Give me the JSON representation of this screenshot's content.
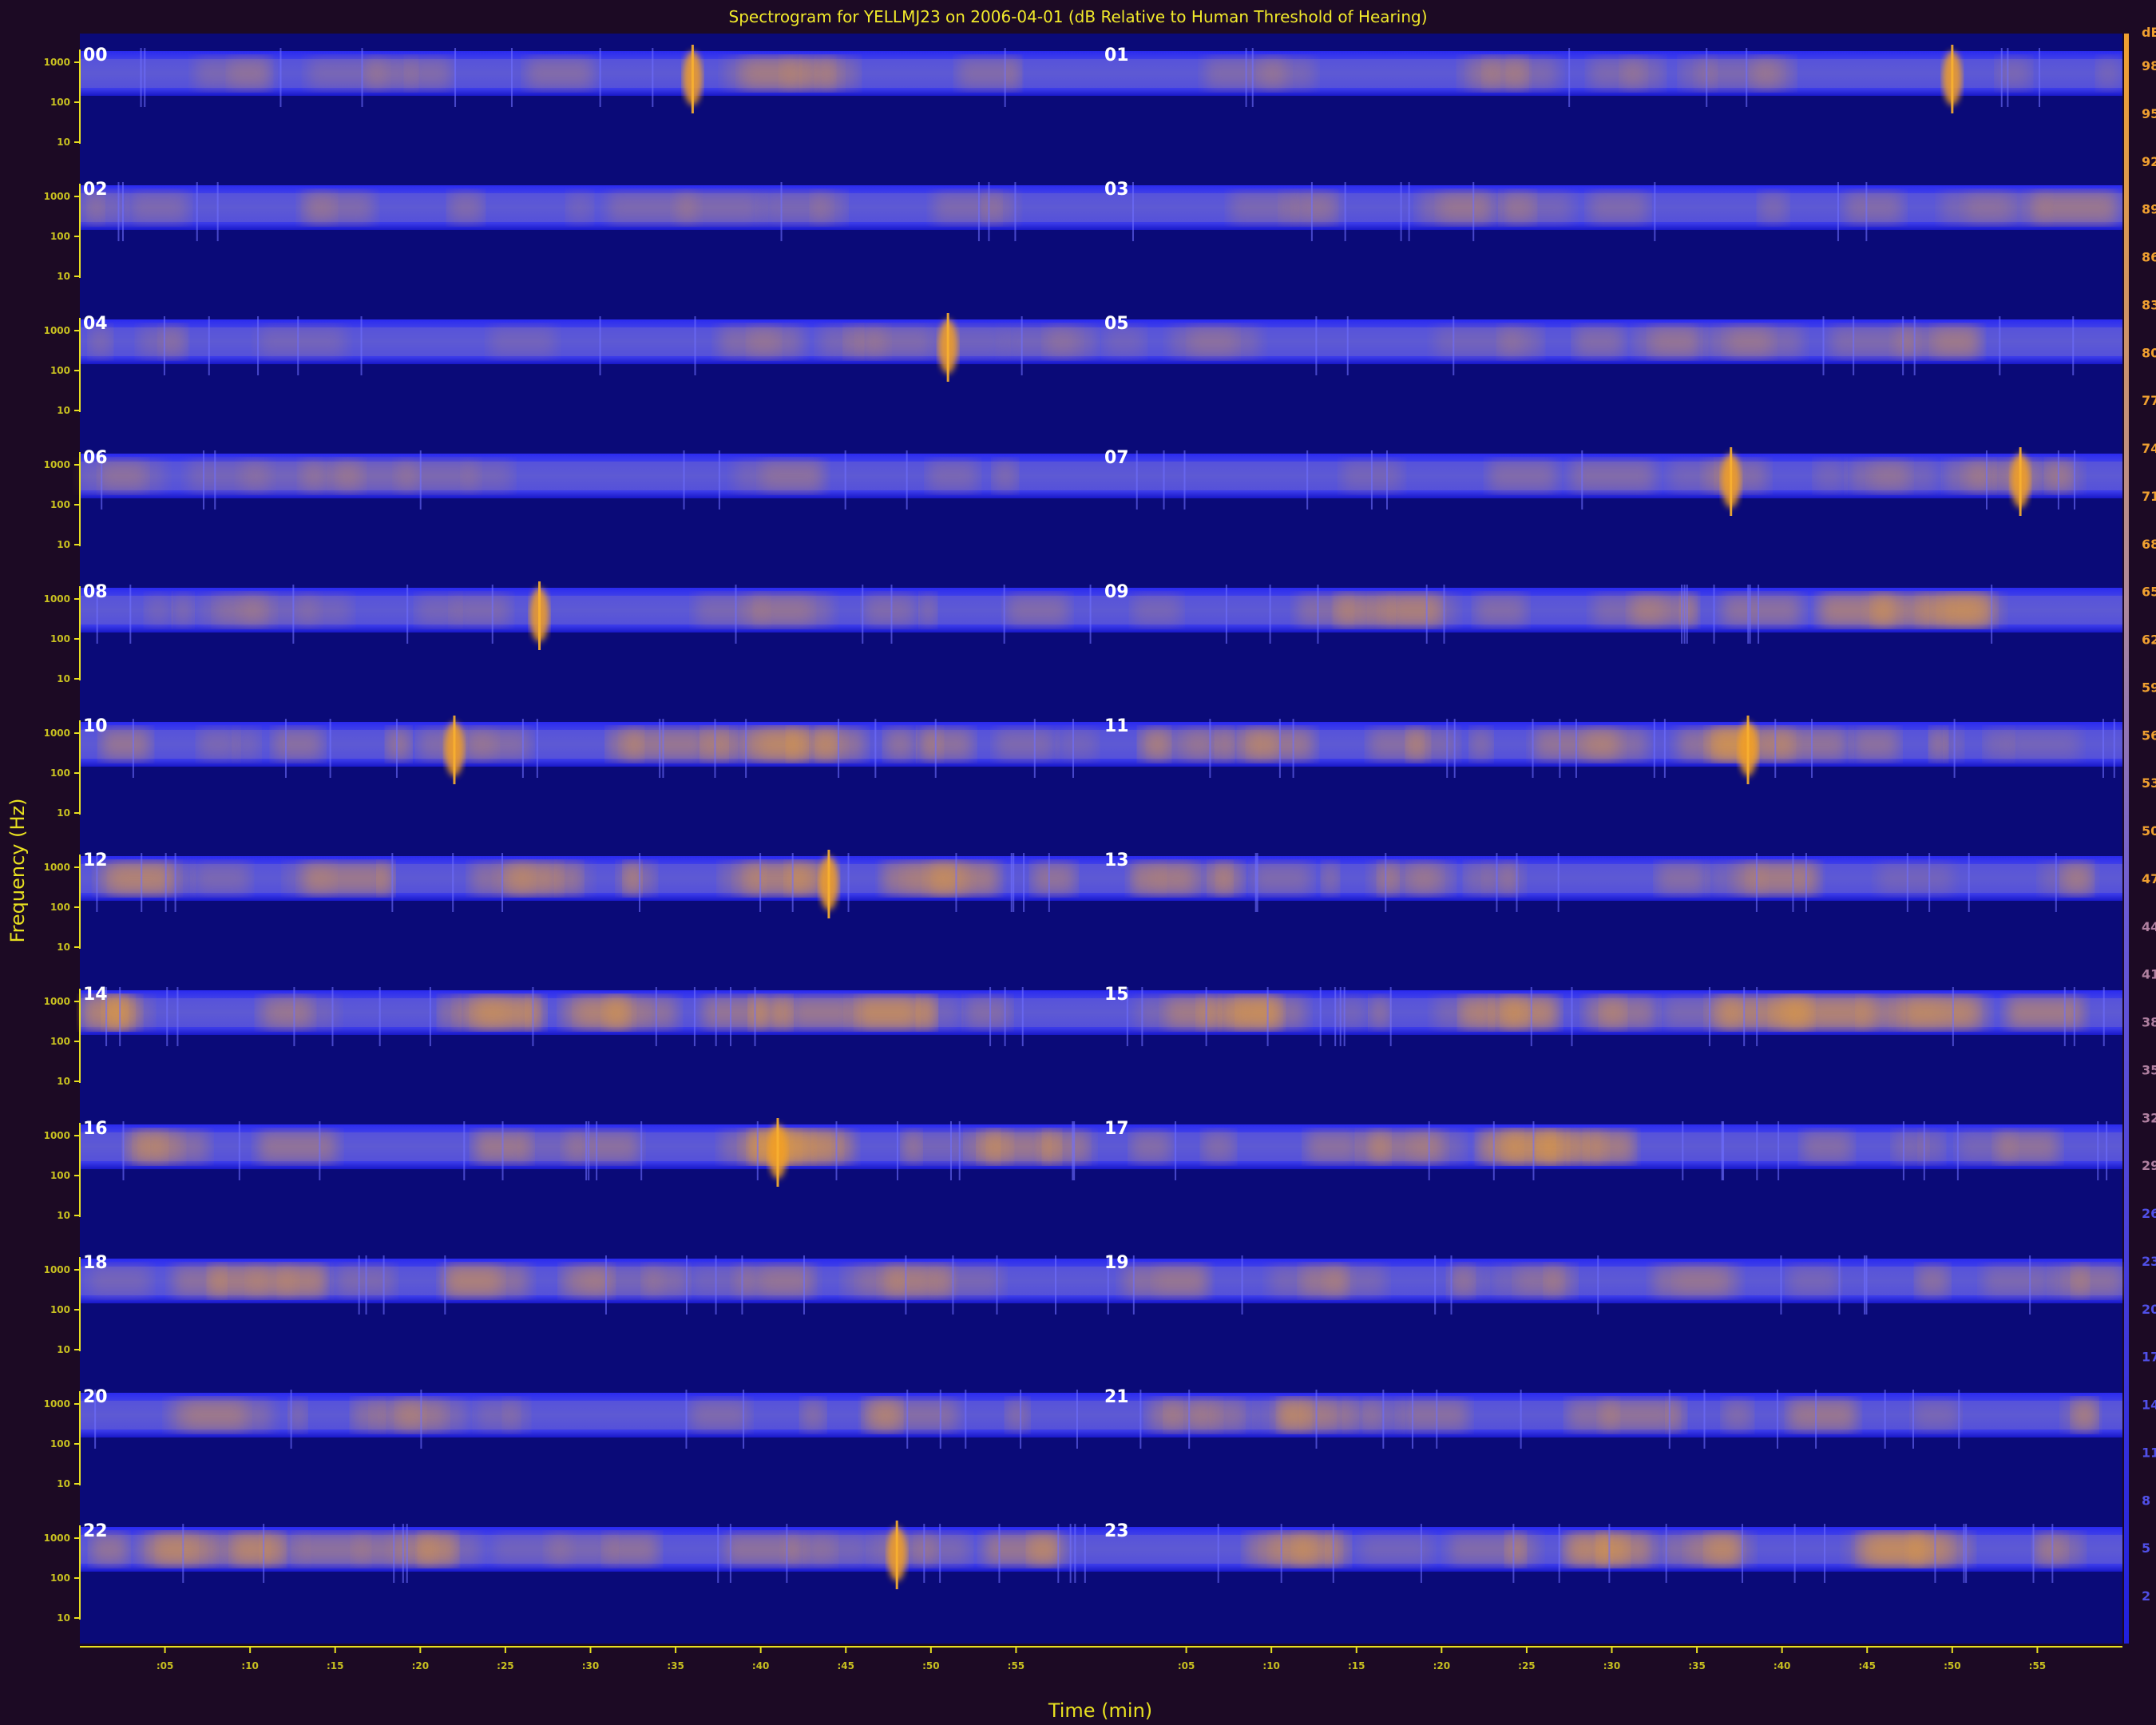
{
  "chart_data": {
    "type": "heatmap",
    "title": "Spectrogram for YELLMJ23 on 2006-04-01 (dB Relative to Human Threshold of Hearing)",
    "xlabel": "Time (min)",
    "ylabel": "Frequency (Hz)",
    "x_tick_labels": [
      ":05",
      ":10",
      ":15",
      ":20",
      ":25",
      ":30",
      ":35",
      ":40",
      ":45",
      ":50",
      ":55"
    ],
    "y_tick_labels": [
      "1000",
      "100",
      "10"
    ],
    "hours": [
      "00",
      "01",
      "02",
      "03",
      "04",
      "05",
      "06",
      "07",
      "08",
      "09",
      "10",
      "11",
      "12",
      "13",
      "14",
      "15",
      "16",
      "17",
      "18",
      "19",
      "20",
      "21",
      "22",
      "23"
    ],
    "colorbar": {
      "unit": "dB",
      "ticks": [
        98,
        95,
        92,
        89,
        86,
        83,
        80,
        77,
        74,
        71,
        68,
        65,
        62,
        59,
        56,
        53,
        50,
        47,
        44,
        41,
        38,
        35,
        32,
        29,
        26,
        23,
        20,
        17,
        14,
        11,
        8,
        5,
        2
      ],
      "low_color": "#2020e0",
      "high_color": "#f0a030"
    },
    "hour_intensity": [
      0.25,
      0.22,
      0.22,
      0.25,
      0.22,
      0.24,
      0.2,
      0.28,
      0.28,
      0.45,
      0.55,
      0.55,
      0.6,
      0.45,
      0.65,
      0.72,
      0.6,
      0.5,
      0.45,
      0.35,
      0.3,
      0.48,
      0.55,
      0.6
    ],
    "events": [
      {
        "hour": "00",
        "minute": 36,
        "label_free": true
      },
      {
        "hour": "01",
        "minute": 50
      },
      {
        "hour": "04",
        "minute": 51
      },
      {
        "hour": "07",
        "minute": 37
      },
      {
        "hour": "07",
        "minute": 54
      },
      {
        "hour": "08",
        "minute": 27
      },
      {
        "hour": "10",
        "minute": 22
      },
      {
        "hour": "11",
        "minute": 38
      },
      {
        "hour": "12",
        "minute": 44
      },
      {
        "hour": "16",
        "minute": 41
      },
      {
        "hour": "22",
        "minute": 48
      }
    ],
    "colors": {
      "background": "#1c0a24",
      "plot_background": "#0a0a78",
      "axis": "#e8e020"
    }
  }
}
